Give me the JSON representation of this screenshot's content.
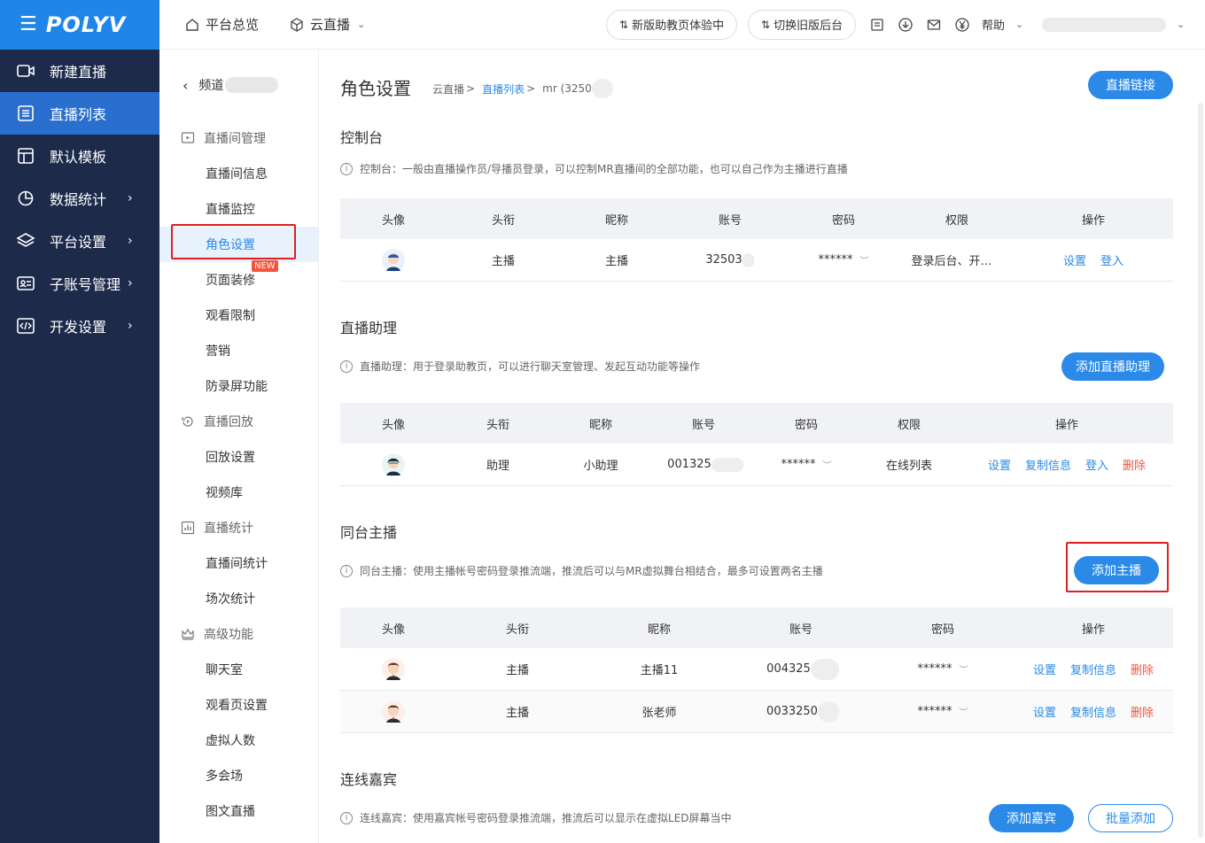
{
  "brand": "POLYV",
  "nav": [
    {
      "label": "新建直播",
      "icon": "video-camera-icon",
      "arrow": false
    },
    {
      "label": "直播列表",
      "icon": "list-icon",
      "arrow": false
    },
    {
      "label": "默认模板",
      "icon": "template-icon",
      "arrow": false
    },
    {
      "label": "数据统计",
      "icon": "pie-chart-icon",
      "arrow": true
    },
    {
      "label": "平台设置",
      "icon": "layers-icon",
      "arrow": true
    },
    {
      "label": "子账号管理",
      "icon": "id-card-icon",
      "arrow": true
    },
    {
      "label": "开发设置",
      "icon": "code-icon",
      "arrow": true
    }
  ],
  "topbar": {
    "overview": "平台总览",
    "cloud_live": "云直播",
    "new_assistant": "新版助教页体验中",
    "switch_old": "切换旧版后台",
    "help": "帮助"
  },
  "subnav": {
    "back_label": "频道",
    "groups": {
      "room_mgmt": "直播间管理",
      "playback": "直播回放",
      "stats": "直播统计",
      "advanced": "高级功能"
    },
    "items": {
      "room_info": "直播间信息",
      "monitor": "直播监控",
      "role_settings": "角色设置",
      "page_decor": "页面装修",
      "new_tag": "NEW",
      "view_limit": "观看限制",
      "marketing": "营销",
      "anti_record": "防录屏功能",
      "playback_settings": "回放设置",
      "video_lib": "视频库",
      "room_stats": "直播间统计",
      "session_stats": "场次统计",
      "chat": "聊天室",
      "watch_page": "观看页设置",
      "virtual_count": "虚拟人数",
      "multi_venue": "多会场",
      "graphic_live": "图文直播"
    }
  },
  "page": {
    "title": "角色设置",
    "breadcrumb": [
      "云直播",
      ">",
      "直播列表",
      ">",
      "mr (3250"
    ],
    "live_link_button": "直播链接"
  },
  "console": {
    "title": "控制台",
    "tip": "控制台：一般由直播操作员/导播员登录，可以控制MR直播间的全部功能，也可以自己作为主播进行直播",
    "headers": [
      "头像",
      "头衔",
      "昵称",
      "账号",
      "密码",
      "权限",
      "操作"
    ],
    "row": {
      "title": "主播",
      "nickname": "主播",
      "account": "32503",
      "password": "******",
      "permission": "登录后台、开…",
      "action_settings": "设置",
      "action_login": "登入"
    }
  },
  "assistant": {
    "title": "直播助理",
    "tip": "直播助理：用于登录助教页，可以进行聊天室管理、发起互动功能等操作",
    "add_button": "添加直播助理",
    "headers": [
      "头像",
      "头衔",
      "昵称",
      "账号",
      "密码",
      "权限",
      "操作"
    ],
    "row": {
      "title": "助理",
      "nickname": "小助理",
      "account": "001325",
      "password": "******",
      "permission": "在线列表",
      "action_settings": "设置",
      "action_copy": "复制信息",
      "action_login": "登入",
      "action_delete": "删除"
    }
  },
  "cohost": {
    "title": "同台主播",
    "tip": "同台主播：使用主播帐号密码登录推流端，推流后可以与MR虚拟舞台相结合，最多可设置两名主播",
    "add_button": "添加主播",
    "headers": [
      "头像",
      "头衔",
      "昵称",
      "账号",
      "密码",
      "操作"
    ],
    "rows": [
      {
        "title": "主播",
        "nickname": "主播11",
        "account": "004325",
        "password": "******",
        "action_settings": "设置",
        "action_copy": "复制信息",
        "action_delete": "删除"
      },
      {
        "title": "主播",
        "nickname": "张老师",
        "account": "0033250",
        "password": "******",
        "action_settings": "设置",
        "action_copy": "复制信息",
        "action_delete": "删除"
      }
    ]
  },
  "guests": {
    "title": "连线嘉宾",
    "tip": "连线嘉宾：使用嘉宾帐号密码登录推流端，推流后可以显示在虚拟LED屏幕当中",
    "add_button": "添加嘉宾",
    "batch_button": "批量添加"
  },
  "colors": {
    "nav_bg": "#1d2a4a",
    "accent": "#2b8ae8",
    "active_nav": "#2b6fce",
    "danger": "#f2543d",
    "highlight_box": "#e02020"
  }
}
